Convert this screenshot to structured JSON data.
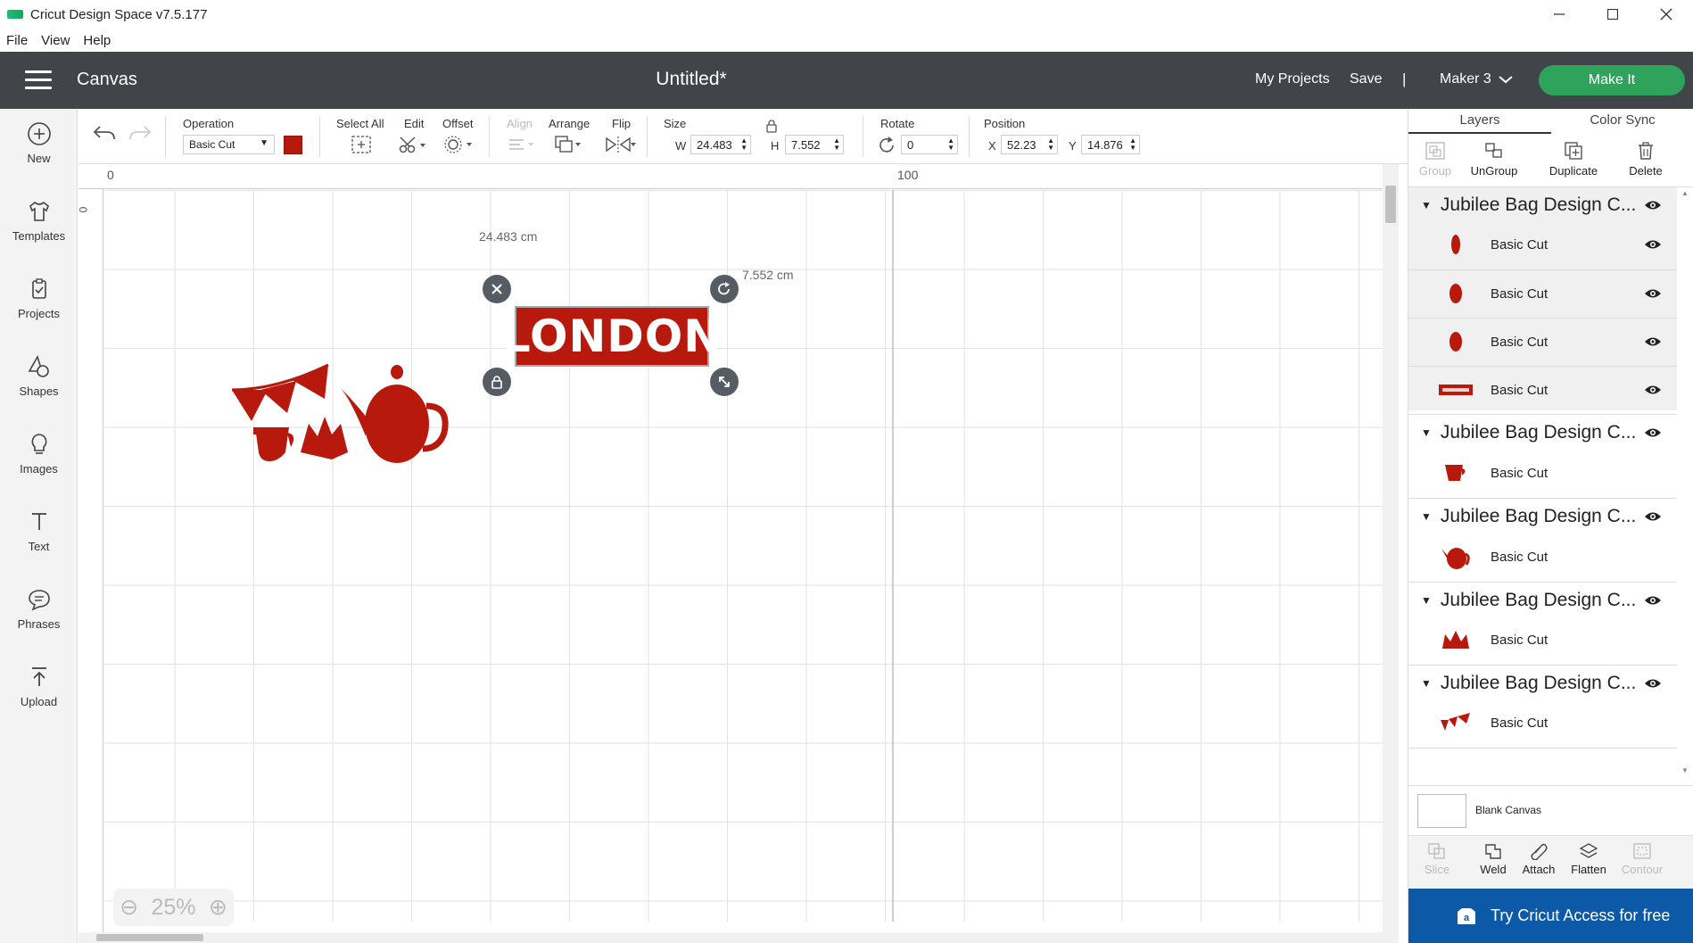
{
  "app": {
    "window_title": "Cricut Design Space  v7.5.177",
    "menu": [
      "File",
      "View",
      "Help"
    ]
  },
  "header": {
    "section": "Canvas",
    "doc_title": "Untitled*",
    "my_projects": "My Projects",
    "save": "Save",
    "separator": "|",
    "machine": "Maker 3",
    "make_it": "Make It",
    "accent_color": "#2fa35c",
    "bar_color": "#414449"
  },
  "leftnav": {
    "items": [
      {
        "label": "New",
        "icon": "plus-circle-icon"
      },
      {
        "label": "Templates",
        "icon": "shirt-icon"
      },
      {
        "label": "Projects",
        "icon": "clipboard-icon"
      },
      {
        "label": "Shapes",
        "icon": "shapes-icon"
      },
      {
        "label": "Images",
        "icon": "lightbulb-icon"
      },
      {
        "label": "Text",
        "icon": "text-icon"
      },
      {
        "label": "Phrases",
        "icon": "speech-bubble-icon"
      },
      {
        "label": "Upload",
        "icon": "upload-icon"
      }
    ]
  },
  "toolbar": {
    "operation_label": "Operation",
    "operation_value": "Basic Cut",
    "operation_color": "#b8190d",
    "select_all": "Select All",
    "edit": "Edit",
    "offset": "Offset",
    "align": "Align",
    "arrange": "Arrange",
    "flip": "Flip",
    "size_label": "Size",
    "w_label": "W",
    "w_value": "24.483",
    "h_label": "H",
    "h_value": "7.552",
    "rotate_label": "Rotate",
    "rotate_value": "0",
    "position_label": "Position",
    "x_label": "X",
    "x_value": "52.23",
    "y_label": "Y",
    "y_value": "14.876"
  },
  "canvas": {
    "ruler_top_0": "0",
    "ruler_top_100": "100",
    "ruler_left_0": "0",
    "width_dim": "24.483 cm",
    "height_dim": "7.552 cm",
    "selected_text": "LONDON",
    "zoom": "25%",
    "shape_color": "#b8190d"
  },
  "rightpanel": {
    "tabs": [
      "Layers",
      "Color Sync"
    ],
    "actions": [
      "Group",
      "UnGroup",
      "Duplicate",
      "Delete"
    ],
    "groups": [
      {
        "name": "Jubilee Bag Design C...",
        "children": [
          "Basic Cut",
          "Basic Cut",
          "Basic Cut",
          "Basic Cut"
        ]
      },
      {
        "name": "Jubilee Bag Design C...",
        "children": [
          "Basic Cut"
        ]
      },
      {
        "name": "Jubilee Bag Design C...",
        "children": [
          "Basic Cut"
        ]
      },
      {
        "name": "Jubilee Bag Design C...",
        "children": [
          "Basic Cut"
        ]
      },
      {
        "name": "Jubilee Bag Design C...",
        "children": [
          "Basic Cut"
        ]
      }
    ],
    "blank_canvas": "Blank Canvas",
    "bottom_actions": [
      "Slice",
      "Weld",
      "Attach",
      "Flatten",
      "Contour"
    ],
    "try_access": "Try Cricut Access for free"
  }
}
